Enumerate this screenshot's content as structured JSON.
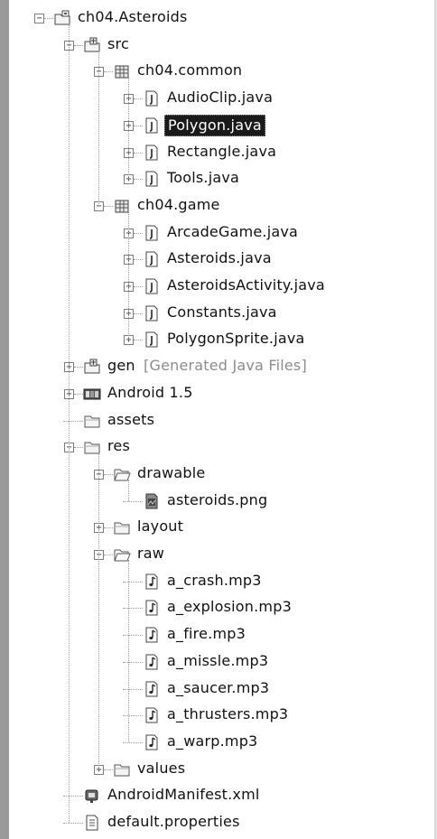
{
  "tree": {
    "nodes": [
      {
        "label": "ch04.Asteroids",
        "indent": 0,
        "toggle": "minus",
        "icon": "project-icon"
      },
      {
        "label": "src",
        "indent": 1,
        "toggle": "minus",
        "icon": "source-folder-icon"
      },
      {
        "label": "ch04.common",
        "indent": 2,
        "toggle": "minus",
        "icon": "package-icon"
      },
      {
        "label": "AudioClip.java",
        "indent": 3,
        "toggle": "plus",
        "icon": "java-file-icon"
      },
      {
        "label": "Polygon.java",
        "indent": 3,
        "toggle": "plus",
        "icon": "java-file-icon",
        "selected": true
      },
      {
        "label": "Rectangle.java",
        "indent": 3,
        "toggle": "plus",
        "icon": "java-file-icon"
      },
      {
        "label": "Tools.java",
        "indent": 3,
        "toggle": "plus",
        "icon": "java-file-icon"
      },
      {
        "label": "ch04.game",
        "indent": 2,
        "toggle": "minus",
        "icon": "package-icon"
      },
      {
        "label": "ArcadeGame.java",
        "indent": 3,
        "toggle": "plus",
        "icon": "java-file-icon"
      },
      {
        "label": "Asteroids.java",
        "indent": 3,
        "toggle": "plus",
        "icon": "java-file-icon"
      },
      {
        "label": "AsteroidsActivity.java",
        "indent": 3,
        "toggle": "plus",
        "icon": "java-file-icon"
      },
      {
        "label": "Constants.java",
        "indent": 3,
        "toggle": "plus",
        "icon": "java-file-icon"
      },
      {
        "label": "PolygonSprite.java",
        "indent": 3,
        "toggle": "plus",
        "icon": "java-file-icon"
      },
      {
        "label": "gen",
        "suffix": "[Generated Java Files]",
        "indent": 1,
        "toggle": "plus",
        "icon": "source-folder-icon"
      },
      {
        "label": "Android 1.5",
        "indent": 1,
        "toggle": "plus",
        "icon": "library-icon"
      },
      {
        "label": "assets",
        "indent": 1,
        "toggle": "none",
        "icon": "folder-icon"
      },
      {
        "label": "res",
        "indent": 1,
        "toggle": "minus",
        "icon": "folder-icon"
      },
      {
        "label": "drawable",
        "indent": 2,
        "toggle": "minus",
        "icon": "open-folder-icon"
      },
      {
        "label": "asteroids.png",
        "indent": 3,
        "toggle": "none",
        "icon": "image-file-icon"
      },
      {
        "label": "layout",
        "indent": 2,
        "toggle": "plus",
        "icon": "folder-icon"
      },
      {
        "label": "raw",
        "indent": 2,
        "toggle": "minus",
        "icon": "open-folder-icon"
      },
      {
        "label": "a_crash.mp3",
        "indent": 3,
        "toggle": "none",
        "icon": "audio-file-icon"
      },
      {
        "label": "a_explosion.mp3",
        "indent": 3,
        "toggle": "none",
        "icon": "audio-file-icon"
      },
      {
        "label": "a_fire.mp3",
        "indent": 3,
        "toggle": "none",
        "icon": "audio-file-icon"
      },
      {
        "label": "a_missle.mp3",
        "indent": 3,
        "toggle": "none",
        "icon": "audio-file-icon"
      },
      {
        "label": "a_saucer.mp3",
        "indent": 3,
        "toggle": "none",
        "icon": "audio-file-icon"
      },
      {
        "label": "a_thrusters.mp3",
        "indent": 3,
        "toggle": "none",
        "icon": "audio-file-icon"
      },
      {
        "label": "a_warp.mp3",
        "indent": 3,
        "toggle": "none",
        "icon": "audio-file-icon"
      },
      {
        "label": "values",
        "indent": 2,
        "toggle": "plus",
        "icon": "folder-icon"
      },
      {
        "label": "AndroidManifest.xml",
        "indent": 1,
        "toggle": "none",
        "icon": "manifest-icon"
      },
      {
        "label": "default.properties",
        "indent": 1,
        "toggle": "none",
        "icon": "properties-file-icon"
      }
    ]
  }
}
